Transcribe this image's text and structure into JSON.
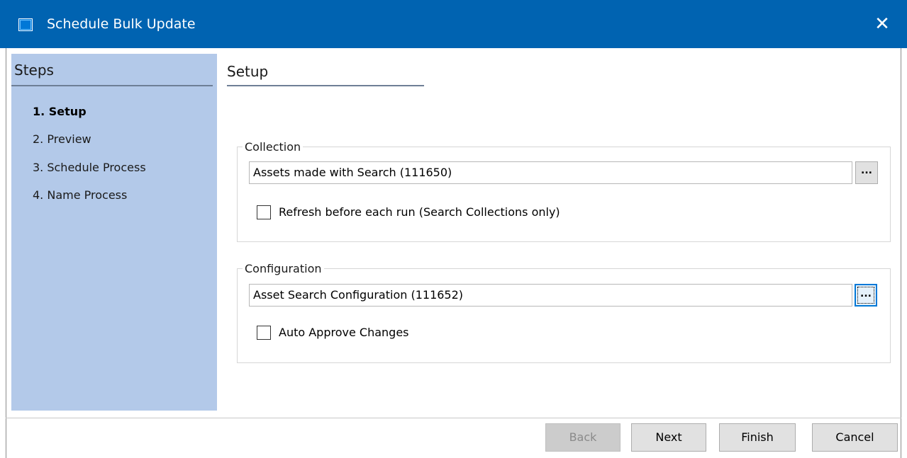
{
  "window": {
    "title": "Schedule Bulk Update",
    "close_glyph": "✕",
    "icon": "app-window-icon"
  },
  "sidebar": {
    "title": "Steps",
    "steps": [
      {
        "label": "1. Setup",
        "active": true
      },
      {
        "label": "2. Preview",
        "active": false
      },
      {
        "label": "3. Schedule Process",
        "active": false
      },
      {
        "label": "4. Name Process",
        "active": false
      }
    ]
  },
  "main": {
    "title": "Setup",
    "collection": {
      "group_label": "Collection",
      "value": "Assets made with Search (111650)",
      "browse_label": "...",
      "checkbox_label": "Refresh before each run (Search Collections only)",
      "checked": false
    },
    "configuration": {
      "group_label": "Configuration",
      "value": "Asset Search Configuration (111652)",
      "browse_label": "...",
      "checkbox_label": "Auto Approve Changes",
      "checked": false
    }
  },
  "footer": {
    "back_label": "Back",
    "next_label": "Next",
    "finish_label": "Finish",
    "cancel_label": "Cancel"
  },
  "colors": {
    "titlebar": "#0063b1",
    "sidebar": "#b3c9e9",
    "focus": "#0078d7"
  }
}
